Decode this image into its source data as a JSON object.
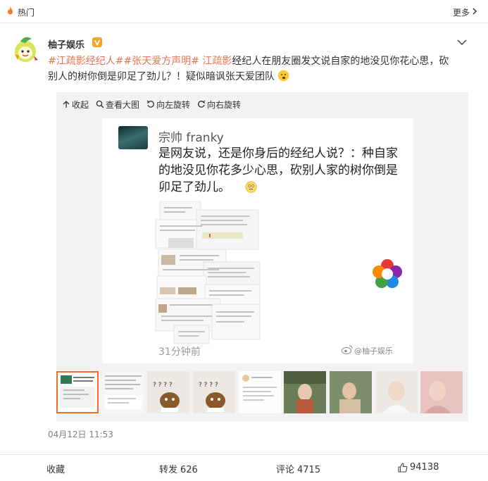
{
  "topbar": {
    "section": "热门",
    "more": "更多"
  },
  "post": {
    "author": "柚子娱乐",
    "text_parts": [
      {
        "t": "#江疏影",
        "cls": "hl"
      },
      {
        "t": "经纪人#",
        "cls": "tag"
      },
      {
        "t": "#张天爱方声明#",
        "cls": "tag"
      },
      {
        "t": " ",
        "cls": ""
      },
      {
        "t": "江疏影",
        "cls": "link"
      },
      {
        "t": "经纪人在朋友圈发文说自家的地没见你花心思，砍别人的树你倒是卯足了劲儿？！疑似暗讽张天爱团队",
        "cls": ""
      }
    ],
    "date": "04月12日 11:53"
  },
  "toolbar": {
    "collapse": "收起",
    "view_large": "查看大图",
    "rotate_left": "向左旋转",
    "rotate_right": "向右旋转"
  },
  "screenshot_post": {
    "name": "宗帅 franky",
    "body": "是网友说，还是你身后的经纪人说？：种自家的地没见你花多少心思，砍别人家的树你倒是卯足了劲儿。",
    "time": "31分钟前",
    "watermark": "@柚子娱乐"
  },
  "thumbnails": [
    {
      "kind": "screenshot",
      "q": ""
    },
    {
      "kind": "doc",
      "q": ""
    },
    {
      "kind": "meme",
      "q": "? ? ? ?"
    },
    {
      "kind": "meme",
      "q": "? ? ? ?"
    },
    {
      "kind": "doc2",
      "q": ""
    },
    {
      "kind": "photo-green",
      "q": ""
    },
    {
      "kind": "photo-green2",
      "q": ""
    },
    {
      "kind": "photo-light",
      "q": ""
    },
    {
      "kind": "photo-pink",
      "q": ""
    }
  ],
  "actions": {
    "favorite": "收藏",
    "forward": "转发",
    "forward_count": "626",
    "comment": "评论",
    "comment_count": "4715",
    "like_count": "94138"
  },
  "colors": {
    "accent": "#eb7350",
    "selected": "#f26d22"
  }
}
